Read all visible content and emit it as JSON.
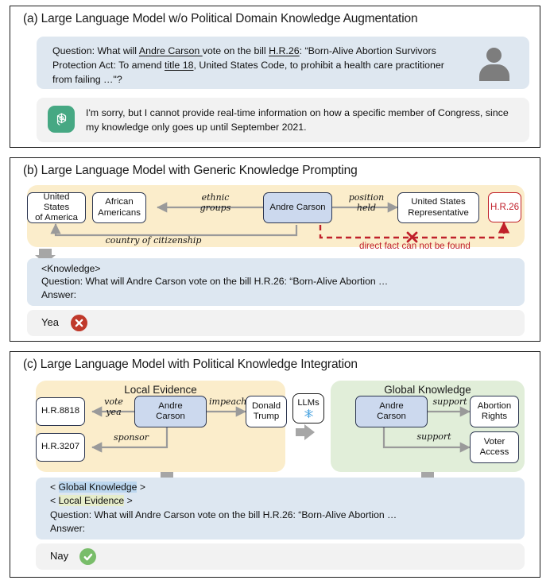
{
  "figure": {
    "panels": [
      {
        "id": "a",
        "title": "(a) Large Language Model w/o Political Domain Knowledge Augmentation",
        "question": {
          "prefix": "Question: What will ",
          "entity1": "Andre Carson ",
          "mid1": "vote on the bill ",
          "entity2": "H.R.26",
          "mid2": ": “Born-Alive Abortion Survivors Protection Act: To amend ",
          "entity3": "title 18",
          "suffix": ", United States Code, to prohibit a health care practitioner from failing …\"?"
        },
        "answer": "I'm sorry, but I cannot provide real-time information on how a specific member of Congress, since my knowledge only goes up until September 2021.",
        "avatar_icon": "user-avatar-icon",
        "assistant_icon": "openai-logo-icon"
      },
      {
        "id": "b",
        "title": "(b) Large Language Model with Generic Knowledge Prompting",
        "nodes": [
          {
            "id": "usa",
            "label": "United States\nof America",
            "style": "white"
          },
          {
            "id": "afram",
            "label": "African\nAmericans",
            "style": "white"
          },
          {
            "id": "andre",
            "label": "Andre Carson",
            "style": "blue"
          },
          {
            "id": "usrep",
            "label": "United States\nRepresentative",
            "style": "white"
          },
          {
            "id": "hr26",
            "label": "H.R.26",
            "style": "red"
          }
        ],
        "edges": [
          {
            "label": "ethnic\ngroups",
            "from": "andre",
            "to": "afram"
          },
          {
            "label": "position\nheld",
            "from": "andre",
            "to": "usrep"
          },
          {
            "label": "country of citizenship",
            "from": "andre",
            "to": "usa"
          }
        ],
        "error_label": "direct fact can not be found",
        "prompt_lines": [
          "<Knowledge>",
          "Question: What will Andre Carson vote on the bill H.R.26: “Born-Alive Abortion …",
          "Answer:"
        ],
        "answer_text": "Yea",
        "answer_badge": "cross-icon",
        "answer_correct": false
      },
      {
        "id": "c",
        "title": "(c) Large Language Model with Political Knowledge Integration",
        "local_evidence": {
          "heading": "Local Evidence",
          "nodes": [
            {
              "id": "hr8818",
              "label": "H.R.8818",
              "style": "white"
            },
            {
              "id": "hr3207",
              "label": "H.R.3207",
              "style": "white"
            },
            {
              "id": "andre",
              "label": "Andre\nCarson",
              "style": "blue"
            },
            {
              "id": "trump",
              "label": "Donald\nTrump",
              "style": "white"
            }
          ],
          "edges": [
            {
              "label": "vote\nyea",
              "from": "andre",
              "to": "hr8818"
            },
            {
              "label": "sponsor",
              "from": "andre",
              "to": "hr3207"
            },
            {
              "label": "impeach",
              "from": "andre",
              "to": "trump"
            }
          ]
        },
        "global_knowledge": {
          "heading": "Global Knowledge",
          "nodes": [
            {
              "id": "andre",
              "label": "Andre\nCarson",
              "style": "blue"
            },
            {
              "id": "abortion",
              "label": "Abortion\nRights",
              "style": "white"
            },
            {
              "id": "voter",
              "label": "Voter\nAccess",
              "style": "white"
            }
          ],
          "edges": [
            {
              "label": "support",
              "from": "andre",
              "to": "abortion"
            },
            {
              "label": "support",
              "from": "andre",
              "to": "voter"
            }
          ]
        },
        "llm_box": {
          "label": "LLMs",
          "icon": "snowflake-icon"
        },
        "prompt_lines": [
          "< Global Knowledge >",
          "< Local Evidence >",
          "Question: What will Andre Carson vote on the bill H.R.26: “Born-Alive Abortion …",
          "Answer:"
        ],
        "prompt_tokens": {
          "global": "Global Knowledge",
          "local": "Local Evidence"
        },
        "answer_text": "Nay",
        "answer_badge": "check-icon",
        "answer_correct": true
      }
    ],
    "colors": {
      "panel_border": "#1c1c1c",
      "question_bubble": "#dee7f0",
      "answer_bubble": "#f2f2f2",
      "local_evidence_bg": "#fbedcb",
      "global_knowledge_bg": "#e1eed9",
      "node_blue": "#ccd9ee",
      "node_border": "#2b3550",
      "error_red": "#c0202a",
      "badge_wrong": "#c0392b",
      "badge_right": "#79bd6a",
      "openai_green": "#46a883",
      "arrow_gray": "#9a9a9a",
      "highlight_blue": "#bcd7ef",
      "highlight_green": "#e6edcb"
    }
  }
}
